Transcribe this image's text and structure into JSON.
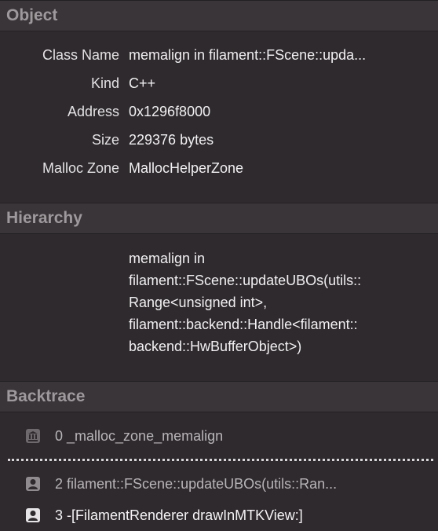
{
  "object_section": {
    "title": "Object",
    "rows": [
      {
        "key": "Class Name",
        "value": "memalign in filament::FScene::upda..."
      },
      {
        "key": "Kind",
        "value": "C++"
      },
      {
        "key": "Address",
        "value": "0x1296f8000"
      },
      {
        "key": "Size",
        "value": "229376 bytes"
      },
      {
        "key": "Malloc Zone",
        "value": "MallocHelperZone"
      }
    ]
  },
  "hierarchy_section": {
    "title": "Hierarchy",
    "lines": [
      "memalign in",
      "filament::FScene::updateUBOs(utils::",
      "Range<unsigned int>,",
      "filament::backend::Handle<filament::",
      "backend::HwBufferObject>)"
    ]
  },
  "backtrace_section": {
    "title": "Backtrace",
    "frames": [
      {
        "label": "0 _malloc_zone_memalign",
        "icon": "library-icon"
      },
      {
        "label": "2 filament::FScene::updateUBOs(utils::Ran...",
        "icon": "user-icon"
      },
      {
        "label": "3 -[FilamentRenderer drawInMTKView:]",
        "icon": "user-icon"
      }
    ]
  },
  "colors": {
    "background": "#2e2a2d",
    "header_background": "#3a3538",
    "header_text": "#9d999c"
  }
}
